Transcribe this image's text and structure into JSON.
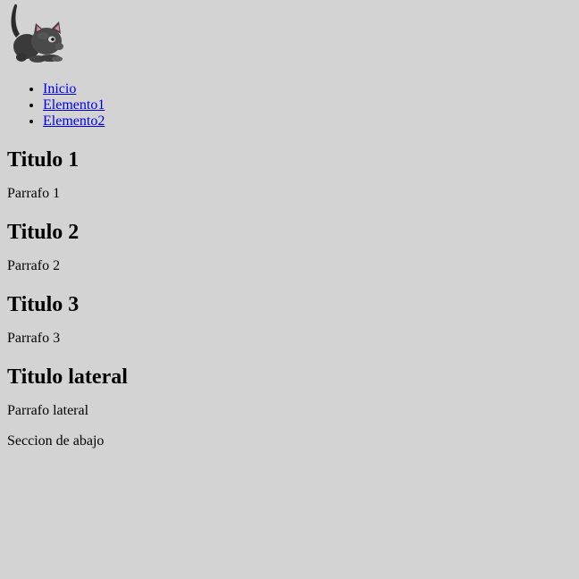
{
  "header": {
    "logo_icon": "kitten-logo-icon"
  },
  "nav": {
    "items": [
      {
        "label": "Inicio"
      },
      {
        "label": "Elemento1"
      },
      {
        "label": "Elemento2"
      }
    ]
  },
  "main": {
    "sections": [
      {
        "title": "Titulo 1",
        "text": "Parrafo 1"
      },
      {
        "title": "Titulo 2",
        "text": "Parrafo 2"
      },
      {
        "title": "Titulo 3",
        "text": "Parrafo 3"
      }
    ]
  },
  "aside": {
    "title": "Titulo lateral",
    "text": "Parrafo lateral"
  },
  "footer": {
    "text": "Seccion de abajo"
  },
  "colors": {
    "background": "#d3d3d3",
    "link": "#0000ee",
    "text": "#000000"
  }
}
